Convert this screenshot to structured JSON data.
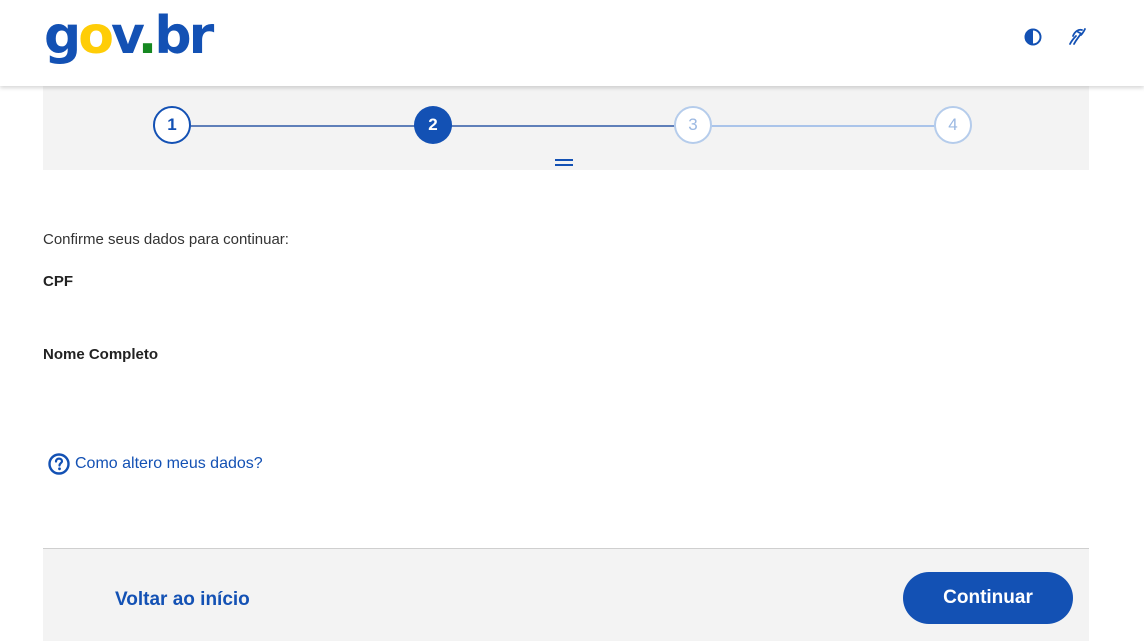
{
  "header": {
    "logo": {
      "g": "g",
      "o": "o",
      "v": "v",
      "dot": ".",
      "b": "b",
      "r": "r"
    },
    "icons": [
      "contrast-icon",
      "sign-language-icon"
    ]
  },
  "stepper": {
    "steps": [
      {
        "number": "1",
        "state": "done"
      },
      {
        "number": "2",
        "state": "current"
      },
      {
        "number": "3",
        "state": "todo"
      },
      {
        "number": "4",
        "state": "todo"
      }
    ]
  },
  "content": {
    "instruction": "Confirme seus dados para continuar:",
    "cpf_label": "CPF",
    "name_label": "Nome Completo",
    "help_link": "Como altero meus dados?"
  },
  "footer": {
    "back_label": "Voltar ao início",
    "continue_label": "Continuar"
  },
  "colors": {
    "primary": "#1351b4",
    "logo_yellow": "#ffcd07",
    "logo_green": "#168821",
    "panel_bg": "#f3f3f3"
  }
}
